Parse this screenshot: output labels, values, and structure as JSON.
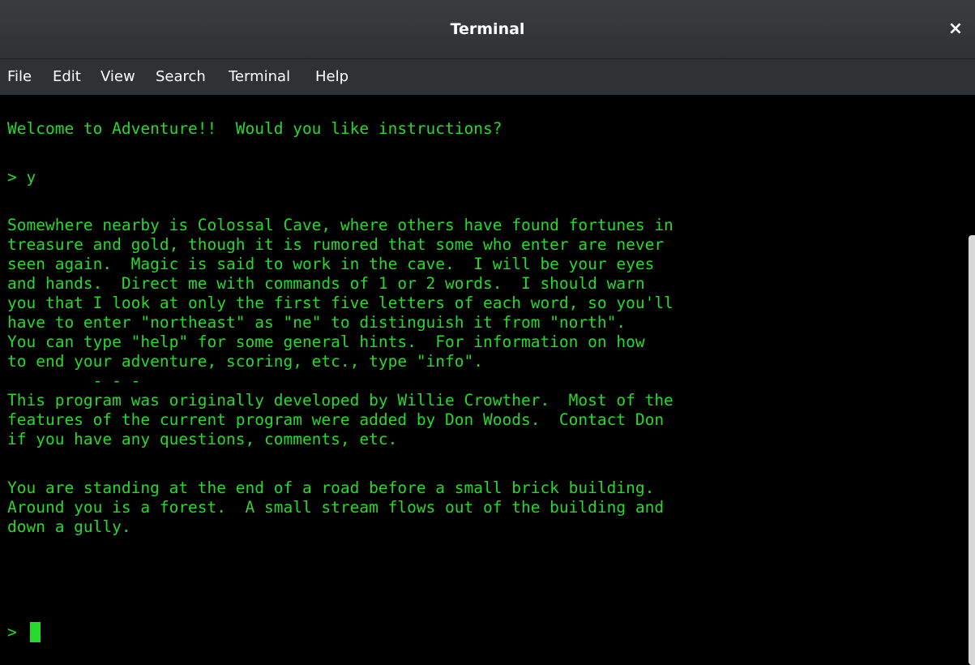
{
  "window": {
    "title": "Terminal",
    "close_glyph": "×"
  },
  "menu": [
    "File",
    "Edit",
    "View",
    "Search",
    "Terminal",
    "Help"
  ],
  "terminal": {
    "text_color": "#27d92a",
    "background": "#000000",
    "lines": [
      "Welcome to Adventure!!  Would you like instructions?",
      "> y",
      "Somewhere nearby is Colossal Cave, where others have found fortunes in",
      "treasure and gold, though it is rumored that some who enter are never",
      "seen again.  Magic is said to work in the cave.  I will be your eyes",
      "and hands.  Direct me with commands of 1 or 2 words.  I should warn",
      "you that I look at only the first five letters of each word, so you'll",
      "have to enter \"northeast\" as \"ne\" to distinguish it from \"north\".",
      "You can type \"help\" for some general hints.  For information on how",
      "to end your adventure, scoring, etc., type \"info\".",
      "         - - -",
      "This program was originally developed by Willie Crowther.  Most of the",
      "features of the current program were added by Don Woods.  Contact Don",
      "if you have any questions, comments, etc.",
      "You are standing at the end of a road before a small brick building.",
      "Around you is a forest.  A small stream flows out of the building and",
      "down a gully.",
      ">"
    ]
  }
}
